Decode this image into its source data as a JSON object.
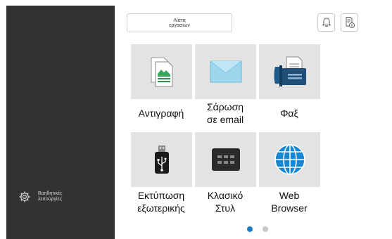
{
  "sidebar": {
    "help_label": "Βοηθητικές\nλειτουργίες",
    "help_icon": "gear-icon"
  },
  "header": {
    "job_list_label": "Λίστα\nεργασιών",
    "bell_icon": "bell-icon",
    "status_icon": "document-info-icon"
  },
  "apps": [
    {
      "label": "Αντιγραφή",
      "icon": "copy-icon"
    },
    {
      "label": "Σάρωση\nσε email",
      "icon": "envelope-icon"
    },
    {
      "label": "Φαξ",
      "icon": "fax-icon"
    },
    {
      "label": "Εκτύπωση\nεξωτερικής",
      "icon": "usb-icon"
    },
    {
      "label": "Κλασικό\nΣτυλ",
      "icon": "keypad-icon"
    },
    {
      "label": "Web\nBrowser",
      "icon": "globe-icon"
    }
  ],
  "pager": {
    "current_page": 1,
    "total_pages": 2
  },
  "colors": {
    "sidebar_bg": "#323232",
    "tile_bg": "#e3e3e3",
    "active_dot": "#1d7fc1",
    "inactive_dot": "#c8c8c8"
  }
}
